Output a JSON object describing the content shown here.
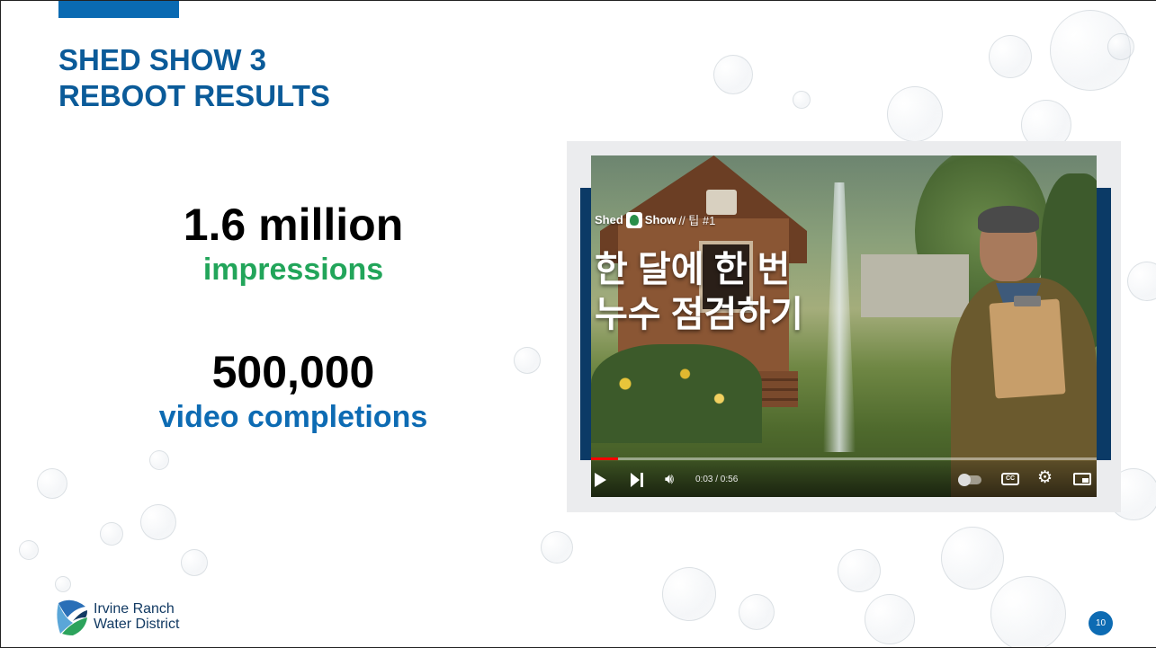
{
  "slide": {
    "title_line1": "SHED SHOW 3",
    "title_line2": "REBOOT RESULTS",
    "page_number": "10"
  },
  "stats": [
    {
      "value": "1.6 million",
      "label": "impressions",
      "label_color": "#22a55a"
    },
    {
      "value": "500,000",
      "label": "video completions",
      "label_color": "#0d6bb3"
    }
  ],
  "video": {
    "brand_shed": "Shed",
    "brand_show": "Show",
    "brand_tip": "// 팁 #1",
    "caption_line1": "한 달에 한 번",
    "caption_line2": "누수 점검하기",
    "time": "0:03 / 0:56",
    "progress": 0.054,
    "icons": [
      "play-icon",
      "next-icon",
      "volume-icon",
      "autoplay-toggle",
      "cc-icon",
      "gear-icon",
      "miniplayer-icon"
    ]
  },
  "logo": {
    "line1": "Irvine Ranch",
    "line2": "Water District"
  },
  "colors": {
    "title": "#0b5b99",
    "accent_bar": "#0a6ab2",
    "frame_bars": "#0b3a66",
    "page_badge": "#0d6bb3"
  }
}
